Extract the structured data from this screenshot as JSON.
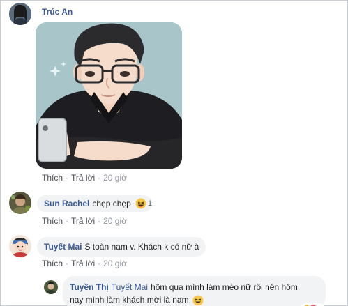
{
  "comments": [
    {
      "author": "Trúc An",
      "image_alt": "Drawing of man with glasses holding phone",
      "actions": {
        "like": "Thích",
        "reply": "Trả lời",
        "time": "20 giờ"
      }
    },
    {
      "author_first": "Sun",
      "author_last": "Rachel",
      "text": "chẹp chẹp",
      "reaction_count": "1",
      "actions": {
        "like": "Thích",
        "reply": "Trả lời",
        "time": "20 giờ"
      }
    },
    {
      "author": "Tuyết Mai",
      "text": "S toàn nam v. Khách k có nữ à",
      "actions": {
        "like": "Thích",
        "reply": "Trả lời",
        "time": "20 giờ"
      }
    },
    {
      "author": "Tuyền Thị",
      "mention": "Tuyết Mai",
      "text_line1": "hôm qua mình làm mèo nữ rồi nên hôm",
      "text_line2": "nay mình làm khách mời là nam"
    }
  ],
  "colors": {
    "author": "#385898",
    "bubble": "#f2f3f5",
    "meta": "#90949c"
  }
}
